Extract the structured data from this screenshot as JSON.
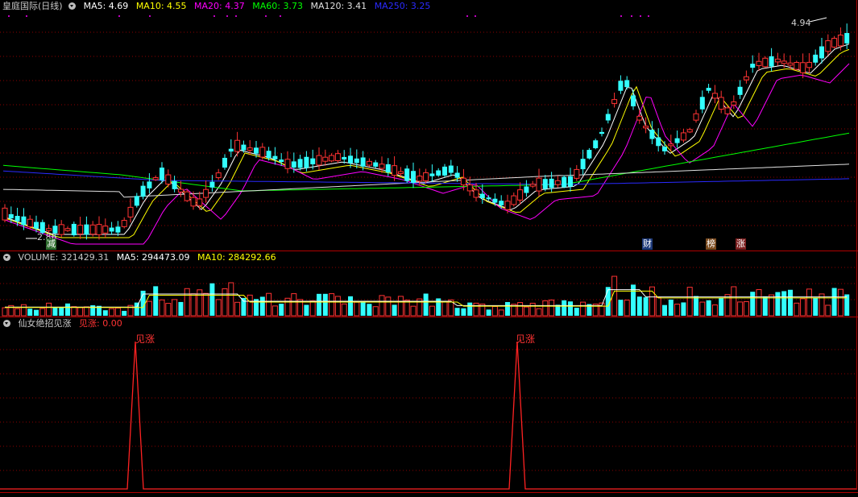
{
  "main_panel": {
    "title": "皇庭国际(日线)",
    "ma": [
      {
        "label": "MA5: 4.69",
        "color": "#ffffff"
      },
      {
        "label": "MA10: 4.55",
        "color": "#ffff00"
      },
      {
        "label": "MA20: 4.37",
        "color": "#ff00ff"
      },
      {
        "label": "MA60: 3.73",
        "color": "#00ff00"
      },
      {
        "label": "MA120: 3.41",
        "color": "#e0e0e0"
      },
      {
        "label": "MA250: 3.25",
        "color": "#2a2aff"
      }
    ],
    "high_label": "4.94",
    "low_label": "2.86",
    "badges": [
      {
        "text": "减",
        "bg": "#2e6b2e",
        "color": "#ffffff"
      },
      {
        "text": "财",
        "bg": "#1e3a7a",
        "color": "#ffffff"
      },
      {
        "text": "榜",
        "bg": "#7a4a1e",
        "color": "#ffffff"
      },
      {
        "text": "涨",
        "bg": "#7a1e1e",
        "color": "#ffffff"
      }
    ]
  },
  "volume_panel": {
    "label": "VOLUME: 321429.31",
    "ma5": "MA5: 294473.09",
    "ma10": "MA10: 284292.66"
  },
  "indicator_panel": {
    "name": "仙女绝招见涨",
    "value": "见涨: 0.00",
    "signals": [
      {
        "label": "见涨"
      },
      {
        "label": "见涨"
      }
    ]
  },
  "colors": {
    "up": "#ff3333",
    "down": "#33ffff",
    "grid": "#8b0000",
    "frame": "#b00000"
  }
}
